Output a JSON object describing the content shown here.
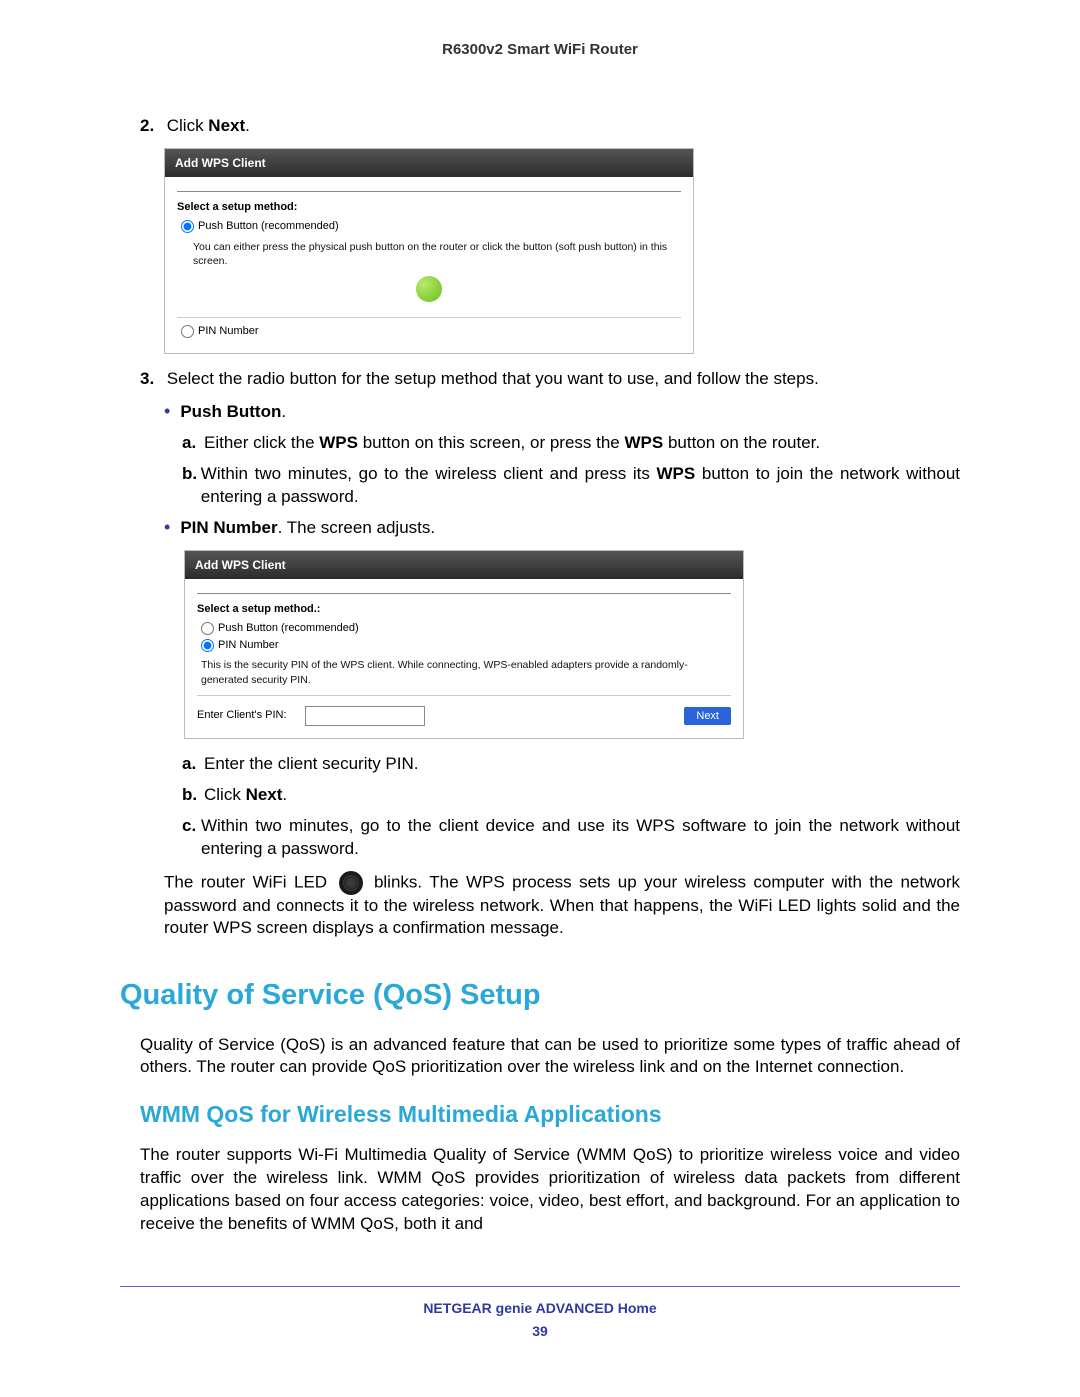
{
  "header": {
    "product": "R6300v2 Smart WiFi Router"
  },
  "step2": {
    "num": "2.",
    "prefix": "Click ",
    "bold": "Next",
    "suffix": "."
  },
  "widget1": {
    "title": "Add WPS Client",
    "select_label": "Select a setup method:",
    "radio_push": "Push Button (recommended)",
    "desc": "You can either press the physical push button on the router or click the button (soft push button) in this screen.",
    "radio_pin": "PIN Number"
  },
  "step3": {
    "num": "3.",
    "text": "Select the radio button for the setup method that you want to use, and follow the steps.",
    "push_bold": "Push Button",
    "push_suffix": ".",
    "a_prefix": "Either click the ",
    "a_bold1": "WPS",
    "a_mid": " button on this screen, or press the ",
    "a_bold2": "WPS",
    "a_suffix": " button on the router.",
    "b_prefix": "Within two minutes, go to the wireless client and press its ",
    "b_bold": "WPS",
    "b_suffix": " button to join the network without entering a password.",
    "pin_bold": "PIN Number",
    "pin_suffix": ". The screen adjusts."
  },
  "widget2": {
    "title": "Add WPS Client",
    "select_label": "Select a setup method.:",
    "radio_push": "Push Button (recommended)",
    "radio_pin": "PIN Number",
    "desc": "This is the security PIN of the WPS client. While connecting, WPS-enabled adapters provide a randomly-generated security PIN.",
    "enter_label": "Enter Client's PIN:",
    "next": "Next"
  },
  "pin_steps": {
    "a": "Enter the client security PIN.",
    "b_prefix": "Click ",
    "b_bold": "Next",
    "b_suffix": ".",
    "c": "Within two minutes, go to the client device and use its WPS software to join the network without entering a password."
  },
  "led_para": {
    "p1": "The router WiFi LED ",
    "p2": " blinks. The WPS process sets up your wireless computer with the network password and connects it to the wireless network. When that happens, the WiFi LED lights solid and the router WPS screen displays a confirmation message."
  },
  "qos": {
    "h1": "Quality of Service (QoS) Setup",
    "intro": "Quality of Service (QoS) is an advanced feature that can be used to prioritize some types of traffic ahead of others. The router can provide QoS prioritization over the wireless link and on the Internet connection.",
    "h2": "WMM QoS for Wireless Multimedia Applications",
    "body": "The router supports Wi-Fi Multimedia Quality of Service (WMM QoS) to prioritize wireless voice and video traffic over the wireless link. WMM QoS provides prioritization of wireless data packets from different applications based on four access categories: voice, video, best effort, and background. For an application to receive the benefits of WMM QoS, both it and"
  },
  "footer": {
    "line1": "NETGEAR genie ADVANCED Home",
    "page": "39"
  }
}
